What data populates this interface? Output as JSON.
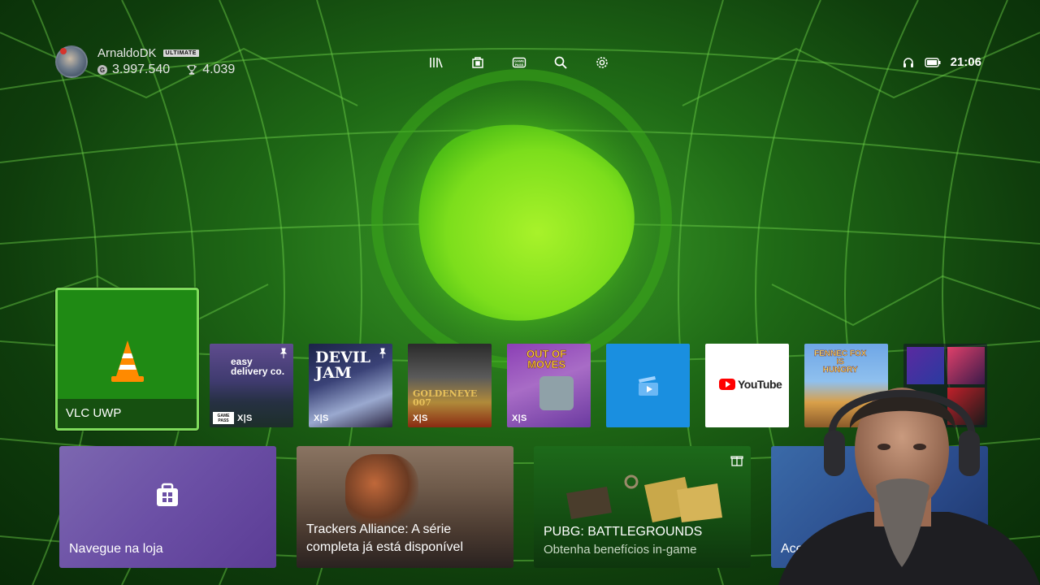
{
  "profile": {
    "gamertag": "ArnaldoDK",
    "badge": "ULTIMATE",
    "gamerscore": "3.997.540",
    "achievements": "4.039",
    "avatar_icon": "avatar-icon"
  },
  "nav": {
    "icons": [
      "library-icon",
      "store-icon",
      "game-pass-icon",
      "search-icon",
      "settings-icon"
    ]
  },
  "status": {
    "headset_icon": "headset-icon",
    "battery_icon": "battery-icon",
    "time": "21:06"
  },
  "tiles": {
    "vlc": {
      "label": "VLC UWP"
    },
    "easy_delivery": {
      "title": "easy\ndelivery co.",
      "platform": "X|S",
      "gamepass": "GAME PASS"
    },
    "devil_jam": {
      "title": "DEVIL\nJAM",
      "platform": "X|S"
    },
    "goldeneye": {
      "title": "GOLDENEYE 007",
      "platform": "X|S"
    },
    "out_of_moves": {
      "title": "OUT OF\nMOVES",
      "platform": "X|S"
    },
    "movies": {
      "icon": "movies-tv-icon"
    },
    "youtube": {
      "logo_text": "YouTube"
    },
    "fennec": {
      "title": "FENNEC FOX\nIS\nHUNGRY"
    }
  },
  "cards": {
    "store": {
      "label": "Navegue na loja"
    },
    "trackers": {
      "label": "Trackers Alliance: A série completa já está disponível"
    },
    "pubg": {
      "label": "PUBG: BATTLEGROUNDS",
      "sub": "Obtenha benefícios in-game"
    },
    "access": {
      "label": "Ace"
    }
  },
  "colors": {
    "accent": "#7fdc5c",
    "vlc_tile": "#1f8a14",
    "movies_tile": "#1a8fe0",
    "youtube_red": "#ff0000"
  }
}
